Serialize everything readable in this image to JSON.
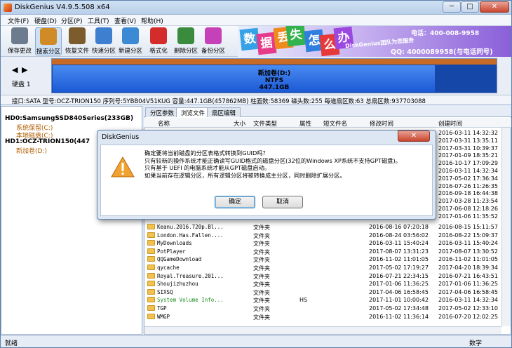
{
  "window": {
    "title": "DiskGenius V4.9.5.508 x64",
    "min": "─",
    "max": "□",
    "close": "✕"
  },
  "menu": [
    "文件(F)",
    "硬盘(D)",
    "分区(P)",
    "工具(T)",
    "查看(V)",
    "帮助(H)"
  ],
  "toolbar": [
    {
      "label": "保存更改",
      "icon": "save-icon",
      "color": "#6d7b8f"
    },
    {
      "label": "搜索分区",
      "icon": "search-icon",
      "color": "#d08b26"
    },
    {
      "label": "恢复文件",
      "icon": "recover-icon",
      "color": "#7c5b2d"
    },
    {
      "label": "快速分区",
      "icon": "disk-icon",
      "color": "#3f7fcf"
    },
    {
      "label": "新建分区",
      "icon": "new-partition-icon",
      "color": "#3c8ad4"
    },
    {
      "label": "格式化",
      "icon": "format-icon",
      "color": "#d42b2b"
    },
    {
      "label": "删除分区",
      "icon": "trash-icon",
      "color": "#3a8b3d"
    },
    {
      "label": "备份分区",
      "icon": "backup-icon",
      "color": "#c640b8"
    }
  ],
  "banner": {
    "chars": [
      "数",
      "据",
      "丢",
      "失",
      "怎",
      "么",
      "办"
    ],
    "char_colors": [
      "#35a1e6",
      "#e63a8a",
      "#f08a1c",
      "#32b34d",
      "#2f7fe0",
      "#e63a3a",
      "#9b48e0"
    ],
    "name": "DiskGenius团队为您服务",
    "phone": "电话：400-008-9958",
    "qq": "QQ: 4000089958(与电话同号)"
  },
  "disk": {
    "label": "硬盘 1",
    "volume_name": "新加卷(D:)",
    "fs": "NTFS",
    "size": "447.1GB",
    "info": "接口:SATA  型号:OCZ-TRION150  序列号:5YBB04V51KUG  容量:447.1GB(457862MB)  柱面数:58369  磁头数:255  每道扇区数:63  总扇区数:937703088"
  },
  "tree": [
    {
      "text": "HD0:SamsungSSD840Series(233GB)",
      "indent": 0,
      "color": "#000",
      "bold": true
    },
    {
      "text": "系统保留(C:)",
      "indent": 2,
      "color": "#b05e00",
      "bold": false
    },
    {
      "text": "本地磁盘(C:)",
      "indent": 2,
      "color": "#b05e00",
      "bold": false
    },
    {
      "text": "HD1:OCZ-TRION150(447",
      "indent": 0,
      "color": "#000",
      "bold": true
    },
    {
      "text": "新加卷(D:)",
      "indent": 2,
      "color": "#b05e00",
      "bold": false,
      "selected": true
    }
  ],
  "tabs": [
    "分区参数",
    "浏览文件",
    "扇区编辑"
  ],
  "columns": [
    "名称",
    "大小",
    "文件类型",
    "属性",
    "短文件名",
    "修改时间",
    "创建时间"
  ],
  "right_dates": [
    "2016-03-11 14:32:32",
    "2017-03-31 13:35:11",
    "2017-03-31 10:39:37",
    "2017-01-09 18:35:21",
    "2016-10-17 17:09:29",
    "2016-03-11 14:32:34",
    "2017-05-02 17:36:34",
    "2016-07-26 11:26:35",
    "2016-09-18 16:44:38",
    "2017-03-28 11:23:54",
    "2017-06-08 12:18:26",
    "2017-01-06 11:35:52"
  ],
  "rows": [
    {
      "name": "Keanu.2016.720p.Bl...",
      "type": "文件夹",
      "attr": "",
      "mod": "2016-08-16 07:20:18",
      "created": "2016-08-15 15:11:57"
    },
    {
      "name": "London.Has.Fallen....",
      "type": "文件夹",
      "attr": "",
      "mod": "2016-08-24 03:56:02",
      "created": "2016-08-22 15:09:37"
    },
    {
      "name": "MyDownloads",
      "type": "文件夹",
      "attr": "",
      "mod": "2016-03-11 15:40:24",
      "created": "2016-03-11 15:40:24"
    },
    {
      "name": "PotPlayer",
      "type": "文件夹",
      "attr": "",
      "mod": "2017-08-07 13:31:23",
      "created": "2017-08-07 13:30:52"
    },
    {
      "name": "QQGameDownload",
      "type": "文件夹",
      "attr": "",
      "mod": "2016-11-02 11:01:05",
      "created": "2016-11-02 11:01:05"
    },
    {
      "name": "qycache",
      "type": "文件夹",
      "attr": "",
      "mod": "2017-05-02 17:19:27",
      "created": "2017-04-20 18:39:34"
    },
    {
      "name": "Royal.Treasure.201...",
      "type": "文件夹",
      "attr": "",
      "mod": "2016-07-21 22:34:15",
      "created": "2016-07-21 16:43:51"
    },
    {
      "name": "Shoujizhuzhou",
      "type": "文件夹",
      "attr": "",
      "mod": "2017-01-06 11:36:25",
      "created": "2017-01-06 11:36:25"
    },
    {
      "name": "SIXSQ",
      "type": "文件夹",
      "attr": "",
      "mod": "2017-04-06 16:58:45",
      "created": "2017-04-06 16:58:45"
    },
    {
      "name": "System Volume Info...",
      "type": "文件夹",
      "attr": "HS",
      "mod": "2017-11-01 10:00:42",
      "created": "2016-03-11 14:32:34",
      "green": true
    },
    {
      "name": "TGP",
      "type": "文件夹",
      "attr": "",
      "mod": "2017-05-02 17:34:48",
      "created": "2017-05-02 12:33:10"
    },
    {
      "name": "WMGP",
      "type": "文件夹",
      "attr": "",
      "mod": "2016-11-02 11:36:14",
      "created": "2016-07-20 12:02:25"
    }
  ],
  "status": {
    "left": "就绪",
    "right": "数字"
  },
  "dialog": {
    "title": "DiskGenius",
    "lines": [
      "确定要将当前磁盘的分区表格式转换到GUID吗？",
      "只有较新的操作系统才能正确读写GUID格式的磁盘分区(32位的Windows XP系统不支持GPT磁盘)。",
      "只有基于 UEFI 的电脑系统才能从GPT磁盘启动。",
      "如果当前存在逻辑分区，所有逻辑分区将被转换成主分区，同时删除扩展分区。"
    ],
    "ok": "确定",
    "cancel": "取消"
  }
}
